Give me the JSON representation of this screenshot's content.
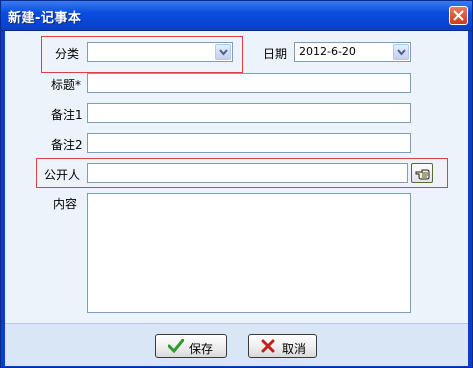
{
  "window": {
    "title": "新建-记事本"
  },
  "form": {
    "category": {
      "label": "分类",
      "value": ""
    },
    "date": {
      "label": "日期",
      "value": "2012-6-20"
    },
    "title": {
      "label": "标题*",
      "value": ""
    },
    "note1": {
      "label": "备注1",
      "value": ""
    },
    "note2": {
      "label": "备注2",
      "value": ""
    },
    "publisher": {
      "label": "公开人",
      "value": ""
    },
    "content": {
      "label": "内容",
      "value": ""
    }
  },
  "buttons": {
    "save": "保存",
    "cancel": "取消"
  },
  "icons": {
    "close": "close-icon",
    "dropdown": "chevron-down-icon",
    "picker": "hand-pointer-icon",
    "save": "checkmark-icon",
    "cancel": "x-icon"
  },
  "colors": {
    "title_bar": "#0a4ee0",
    "highlight": "#e23b4a",
    "panel": "#ecf3fb"
  }
}
